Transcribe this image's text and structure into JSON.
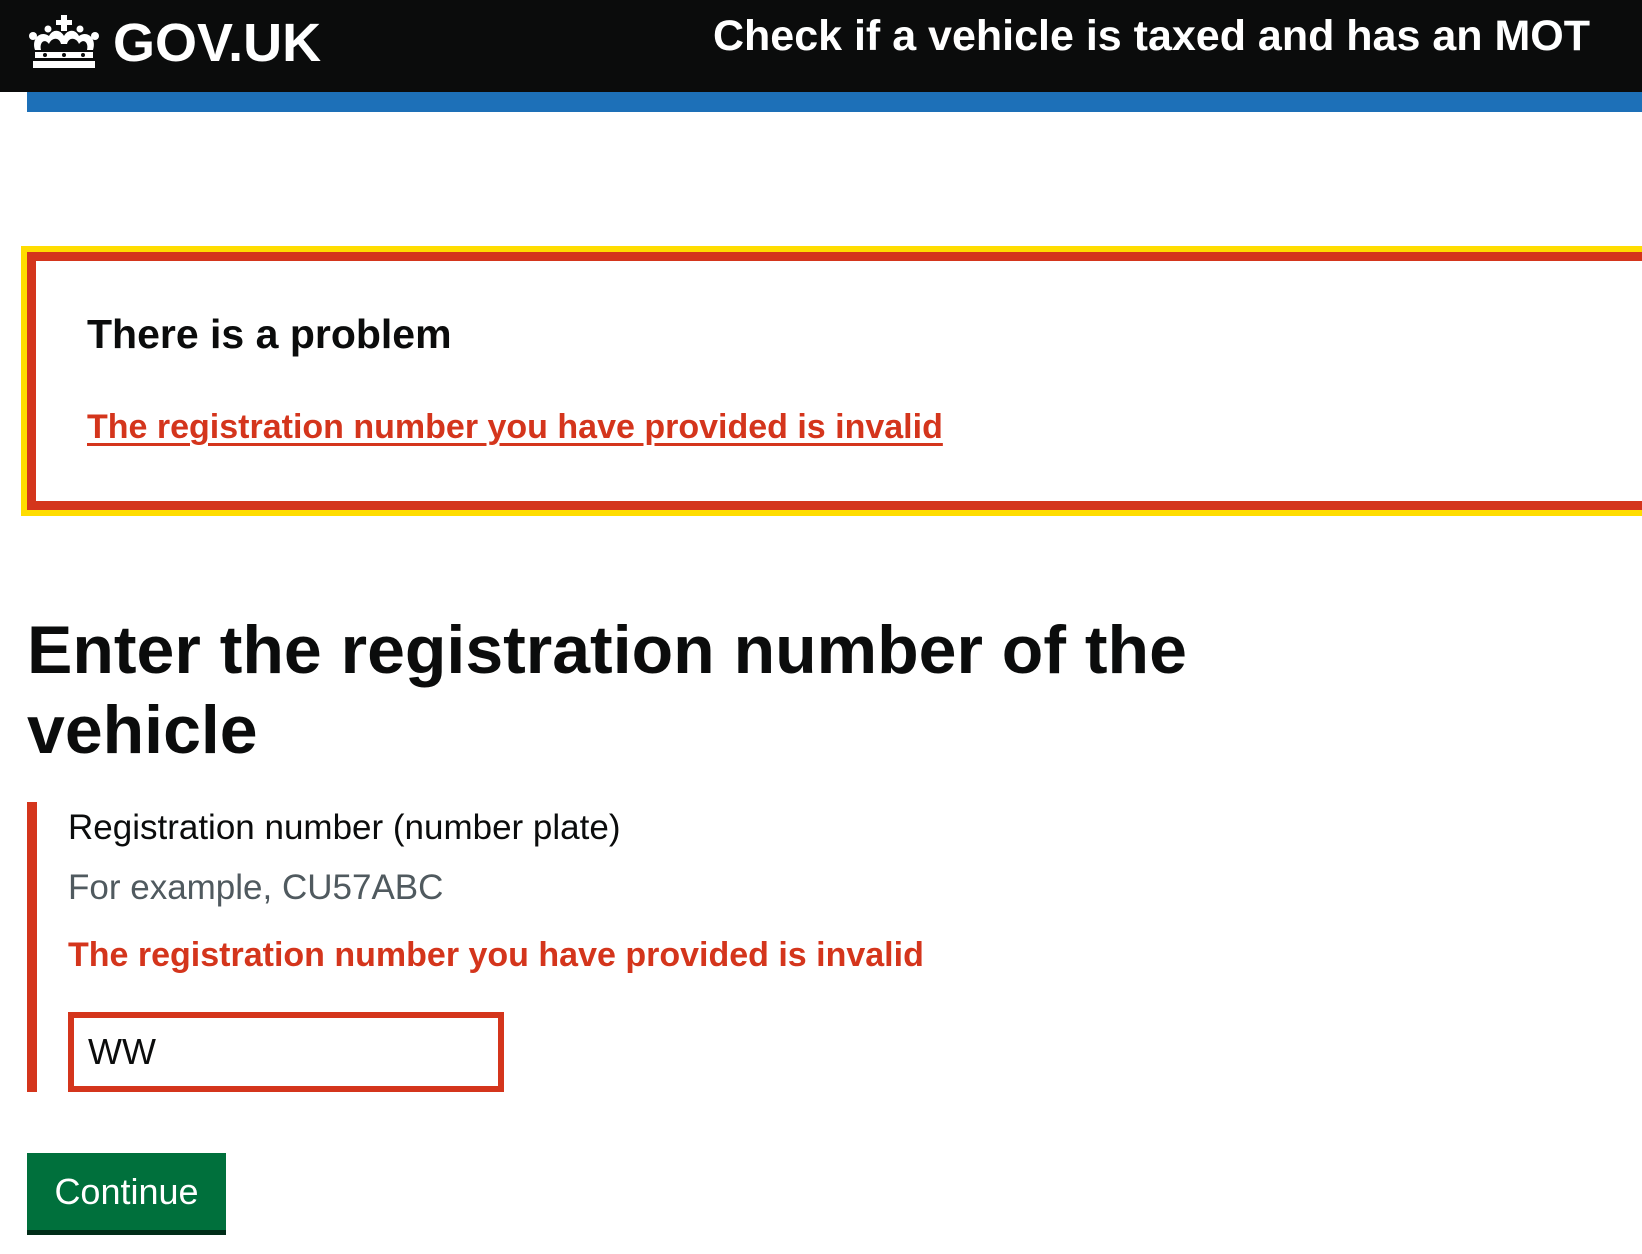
{
  "header": {
    "logo_text": "GOV.UK",
    "service_name": "Check if a vehicle is taxed and has an MOT",
    "crown_icon": "crown-icon"
  },
  "error_summary": {
    "title": "There is a problem",
    "error_link": "The registration number you have provided is invalid"
  },
  "main": {
    "heading": "Enter the registration number of the vehicle",
    "field": {
      "label": "Registration number (number plate)",
      "hint": "For example, CU57ABC",
      "error_message": "The registration number you have provided is invalid",
      "value": "WW"
    },
    "continue_label": "Continue"
  },
  "colors": {
    "header_background": "#0b0c0c",
    "header_bar": "#1d70b8",
    "error": "#d4351c",
    "focus": "#ffdd00",
    "button": "#00703c",
    "hint": "#505a5f"
  }
}
